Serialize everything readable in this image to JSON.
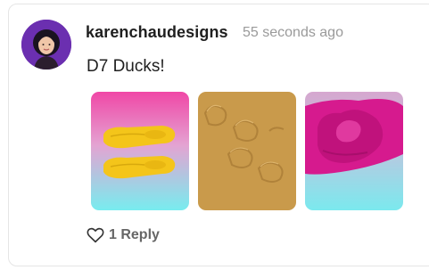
{
  "post": {
    "username": "karenchaudesigns",
    "timestamp": "55 seconds ago",
    "message": "D7 Ducks!"
  },
  "attachments": [
    {
      "icon": "yellow-slipper-soles-image"
    },
    {
      "icon": "embossed-duck-pattern-image"
    },
    {
      "icon": "pink-duck-mold-image"
    }
  ],
  "actions": {
    "like_icon": "heart-icon",
    "reply_count": "1",
    "reply_label": "1 Reply"
  },
  "colors": {
    "accent_purple": "#6b2fb0",
    "pink": "#e93b9c",
    "cyan": "#7ee7ea",
    "mustard": "#c99a4b",
    "sole_yellow": "#f5c518"
  }
}
